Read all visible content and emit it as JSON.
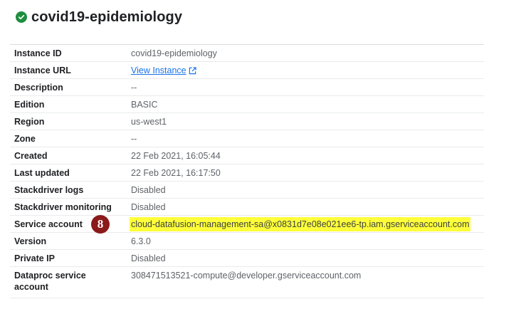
{
  "header": {
    "title": "covid19-epidemiology",
    "status_icon": "check-circle-icon",
    "status_color": "#1e8e3e"
  },
  "details": [
    {
      "label": "Instance ID",
      "value": "covid19-epidemiology"
    },
    {
      "label": "Instance URL",
      "value": "View Instance",
      "is_link": true
    },
    {
      "label": "Description",
      "value": "--"
    },
    {
      "label": "Edition",
      "value": "BASIC"
    },
    {
      "label": "Region",
      "value": "us-west1"
    },
    {
      "label": "Zone",
      "value": "--"
    },
    {
      "label": "Created",
      "value": "22 Feb 2021, 16:05:44"
    },
    {
      "label": "Last updated",
      "value": "22 Feb 2021, 16:17:50"
    },
    {
      "label": "Stackdriver logs",
      "value": "Disabled"
    },
    {
      "label": "Stackdriver monitoring",
      "value": "Disabled"
    },
    {
      "label": "Service account",
      "value": "cloud-datafusion-management-sa@x0831d7e08e021ee6-tp.iam.gserviceaccount.com",
      "marker": "8",
      "highlight_color": "#ffff3a"
    },
    {
      "label": "Version",
      "value": "6.3.0"
    },
    {
      "label": "Private IP",
      "value": "Disabled"
    },
    {
      "label": "Dataproc service account",
      "value": "308471513521-compute@developer.gserviceaccount.com"
    }
  ],
  "colors": {
    "link": "#1a73e8",
    "marker": "#8b1a1a"
  }
}
